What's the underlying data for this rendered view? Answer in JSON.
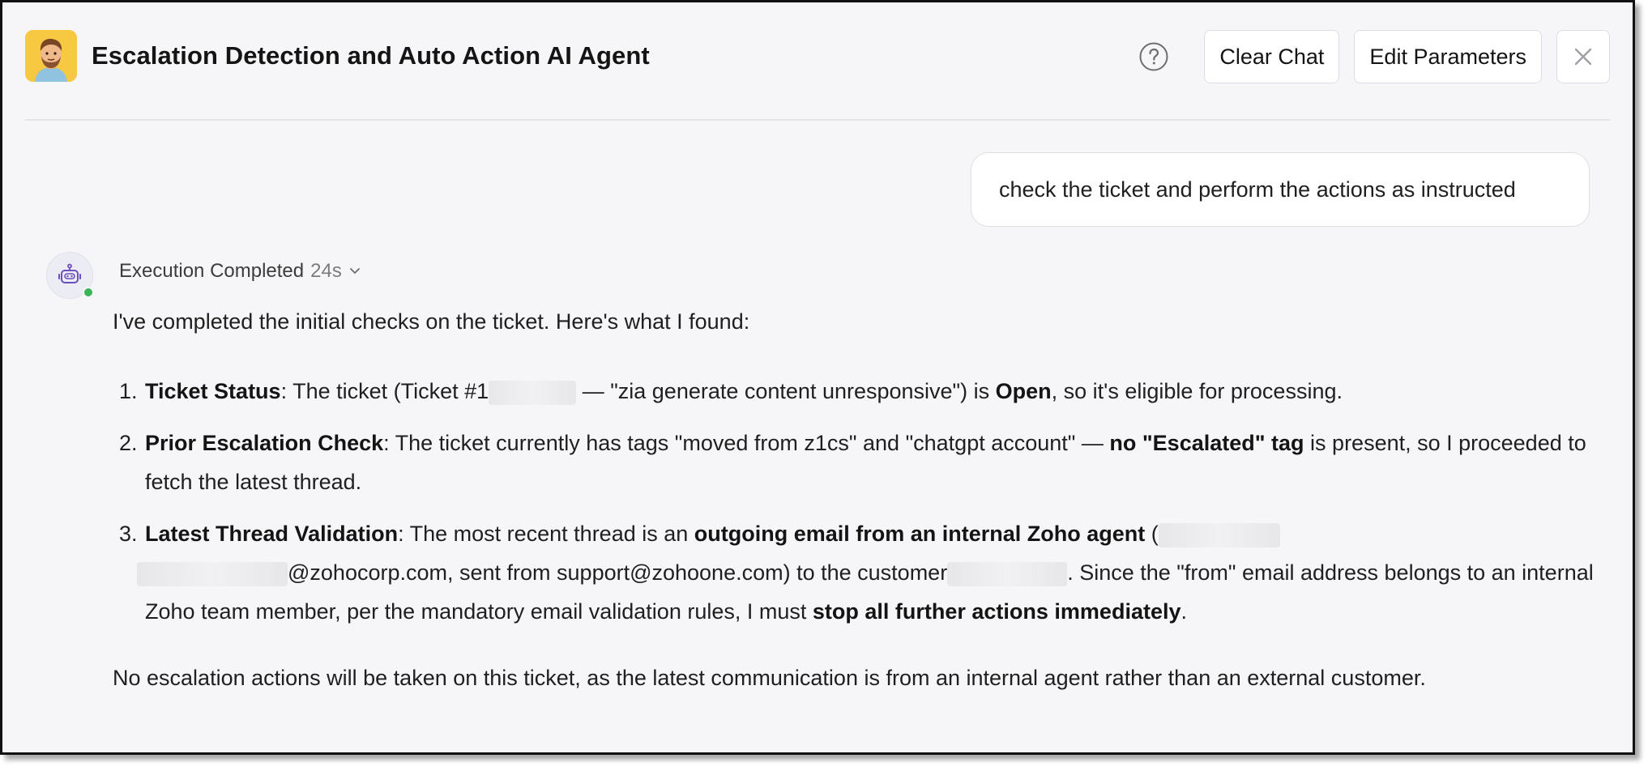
{
  "header": {
    "title": "Escalation Detection and Auto Action AI Agent",
    "help_icon": "question-circle-icon",
    "clear_chat": "Clear Chat",
    "edit_parameters": "Edit Parameters",
    "close_icon": "close-icon"
  },
  "user_message": "check the ticket and perform the actions as instructed",
  "agent": {
    "status": "Execution Completed",
    "duration": "24s",
    "intro": "I've completed the initial checks on the ticket. Here's what I found:",
    "items": [
      {
        "number": "1.",
        "label": "Ticket Status",
        "t1": ": The ticket (Ticket #",
        "t1b": "1",
        "t2": " — \"zia generate content unresponsive\") is ",
        "strong": "Open",
        "t3": ", so it's eligible for processing."
      },
      {
        "number": "2.",
        "label": "Prior Escalation Check",
        "t1": ": The ticket currently has tags \"moved from z1cs\" and \"chatgpt account\" — ",
        "strong": "no \"Escalated\" tag",
        "t2": " is present, so I proceeded to fetch the latest thread."
      },
      {
        "number": "3.",
        "label": "Latest Thread Validation",
        "t1": ": The most recent thread is an ",
        "strong1": "outgoing email from an internal Zoho agent",
        "t2": " (",
        "t3": "@zohocorp.com, sent from ",
        "email": "support@zohoone.com",
        "t4": ") to the customer",
        "t5": ". Since the \"from\" email address belongs to an internal Zoho team member, per the mandatory email validation rules, I must ",
        "strong2": "stop all further actions immediately",
        "t6": "."
      }
    ],
    "closing": "No escalation actions will be taken on this ticket, as the latest communication is from an internal agent rather than an external customer."
  },
  "colors": {
    "background": "#f6f6f8",
    "avatar_bg": "#f7c842",
    "online": "#3cb55a",
    "bot_icon": "#6b4fbf"
  }
}
